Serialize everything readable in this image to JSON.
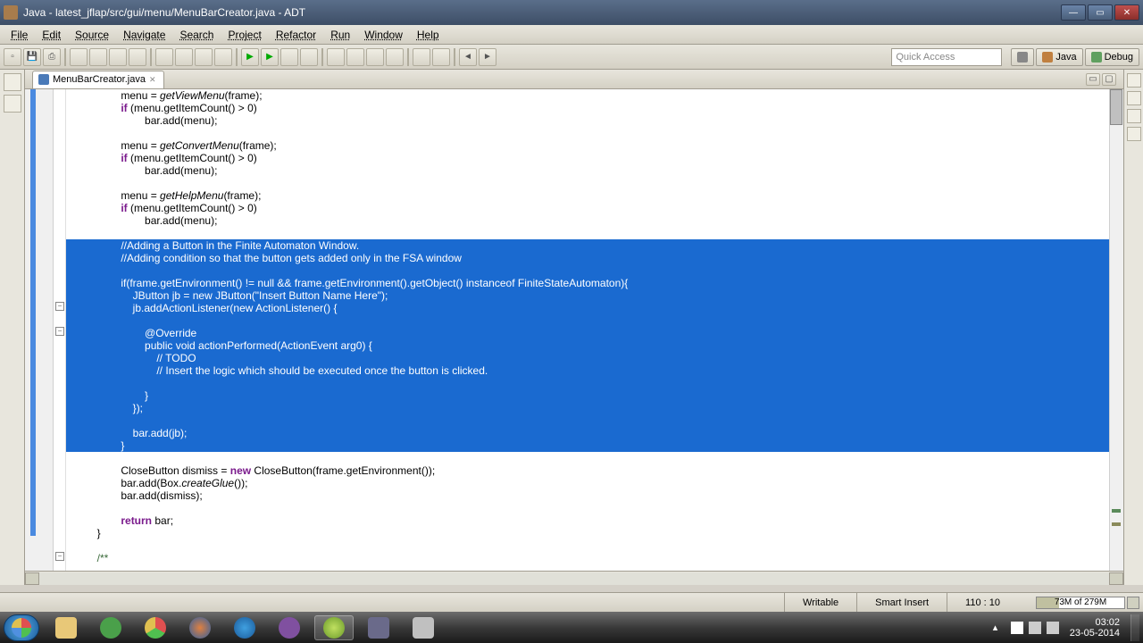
{
  "window": {
    "title": "Java - latest_jflap/src/gui/menu/MenuBarCreator.java - ADT"
  },
  "menubar": {
    "items": [
      "File",
      "Edit",
      "Source",
      "Navigate",
      "Search",
      "Project",
      "Refactor",
      "Run",
      "Window",
      "Help"
    ]
  },
  "toolbar": {
    "quick_access_placeholder": "Quick Access",
    "perspectives": {
      "java": "Java",
      "debug": "Debug"
    }
  },
  "tab": {
    "filename": "MenuBarCreator.java"
  },
  "code": {
    "lines": [
      {
        "t": "                menu = getViewMenu(frame);",
        "sel": false,
        "parts": [
          [
            "                menu = ",
            ""
          ],
          [
            "getViewMenu",
            "it"
          ],
          [
            "(frame);",
            ""
          ]
        ]
      },
      {
        "t": "                if (menu.getItemCount() > 0)",
        "sel": false,
        "parts": [
          [
            "                ",
            ""
          ],
          [
            "if",
            "kw"
          ],
          [
            " (menu.getItemCount() > 0)",
            ""
          ]
        ]
      },
      {
        "t": "                        bar.add(menu);",
        "sel": false
      },
      {
        "t": "",
        "sel": false
      },
      {
        "t": "                menu = getConvertMenu(frame);",
        "sel": false,
        "parts": [
          [
            "                menu = ",
            ""
          ],
          [
            "getConvertMenu",
            "it"
          ],
          [
            "(frame);",
            ""
          ]
        ]
      },
      {
        "t": "                if (menu.getItemCount() > 0)",
        "sel": false,
        "parts": [
          [
            "                ",
            ""
          ],
          [
            "if",
            "kw"
          ],
          [
            " (menu.getItemCount() > 0)",
            ""
          ]
        ]
      },
      {
        "t": "                        bar.add(menu);",
        "sel": false
      },
      {
        "t": "",
        "sel": false
      },
      {
        "t": "                menu = getHelpMenu(frame);",
        "sel": false,
        "parts": [
          [
            "                menu = ",
            ""
          ],
          [
            "getHelpMenu",
            "it"
          ],
          [
            "(frame);",
            ""
          ]
        ]
      },
      {
        "t": "                if (menu.getItemCount() > 0)",
        "sel": false,
        "parts": [
          [
            "                ",
            ""
          ],
          [
            "if",
            "kw"
          ],
          [
            " (menu.getItemCount() > 0)",
            ""
          ]
        ]
      },
      {
        "t": "                        bar.add(menu);",
        "sel": false
      },
      {
        "t": "",
        "sel": false
      },
      {
        "t": "                //Adding a Button in the Finite Automaton Window.",
        "sel": true,
        "cls": "cm"
      },
      {
        "t": "                //Adding condition so that the button gets added only in the FSA window",
        "sel": true,
        "cls": "cm"
      },
      {
        "t": "",
        "sel": true
      },
      {
        "t": "                if(frame.getEnvironment() != null && frame.getEnvironment().getObject() instanceof FiniteStateAutomaton){",
        "sel": true
      },
      {
        "t": "                    JButton jb = new JButton(\"Insert Button Name Here\");",
        "sel": true
      },
      {
        "t": "                    jb.addActionListener(new ActionListener() {",
        "sel": true
      },
      {
        "t": "",
        "sel": true
      },
      {
        "t": "                        @Override",
        "sel": true
      },
      {
        "t": "                        public void actionPerformed(ActionEvent arg0) {",
        "sel": true
      },
      {
        "t": "                            // TODO",
        "sel": true
      },
      {
        "t": "                            // Insert the logic which should be executed once the button is clicked.",
        "sel": true
      },
      {
        "t": "",
        "sel": true
      },
      {
        "t": "                        }",
        "sel": true
      },
      {
        "t": "                    });",
        "sel": true
      },
      {
        "t": "",
        "sel": true
      },
      {
        "t": "                    bar.add(jb);",
        "sel": true
      },
      {
        "t": "                }",
        "sel": true
      },
      {
        "t": "",
        "sel": false
      },
      {
        "t": "                CloseButton dismiss = new CloseButton(frame.getEnvironment());",
        "sel": false,
        "parts": [
          [
            "                CloseButton dismiss = ",
            ""
          ],
          [
            "new",
            "kw"
          ],
          [
            " CloseButton(frame.getEnvironment());",
            ""
          ]
        ]
      },
      {
        "t": "                bar.add(Box.createGlue());",
        "sel": false,
        "parts": [
          [
            "                bar.add(Box.",
            ""
          ],
          [
            "createGlue",
            "it"
          ],
          [
            "());",
            ""
          ]
        ]
      },
      {
        "t": "                bar.add(dismiss);",
        "sel": false
      },
      {
        "t": "",
        "sel": false
      },
      {
        "t": "                return bar;",
        "sel": false,
        "parts": [
          [
            "                ",
            ""
          ],
          [
            "return",
            "kw"
          ],
          [
            " bar;",
            ""
          ]
        ]
      },
      {
        "t": "        }",
        "sel": false
      },
      {
        "t": "",
        "sel": false
      },
      {
        "t": "        /**",
        "sel": false,
        "cls": "cm"
      }
    ]
  },
  "status": {
    "writable": "Writable",
    "insert_mode": "Smart Insert",
    "cursor": "110 : 10",
    "memory": "73M of 279M"
  },
  "clock": {
    "time": "03:02",
    "date": "23-05-2014"
  }
}
